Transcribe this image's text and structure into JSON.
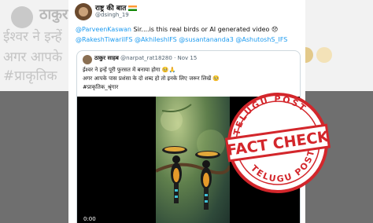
{
  "background": {
    "name": "ठाकुर",
    "line1": "ईश्वर ने इन्हें",
    "line2": "अगर आपके",
    "line3": "#प्राकृतिक"
  },
  "tweet": {
    "display_name": "राष्ट्र की बात",
    "handle": "@dsingh_19",
    "mention_first": "@ParveenKaswan",
    "text": " Sir....is this real birds or AI generated video 😞",
    "mentions": "@RakeshTiwariIFS @AkhileshIFS @susantananda3 @AshutoshS_IFS"
  },
  "quoted": {
    "display_name": "ठाकुर साहब",
    "handle": "@narpat_rat18280",
    "date": "· Nov 15",
    "line1": "ईश्वर ने इन्हें पूरी फुरसत में बनाया होगा 🥺🙏",
    "line2": "अगर आपके पास प्रशंसा के दो शब्द हो तो इनके लिए जरूर लिखें 🥺",
    "line3": "#प्राकृतिक_श्रृंगार",
    "video_time": "0:00"
  },
  "stamp": {
    "top_text": "TELUGU POST",
    "main_text": "FACT CHECK",
    "bottom_text": "TELUGU POST",
    "color": "#d3262b"
  }
}
